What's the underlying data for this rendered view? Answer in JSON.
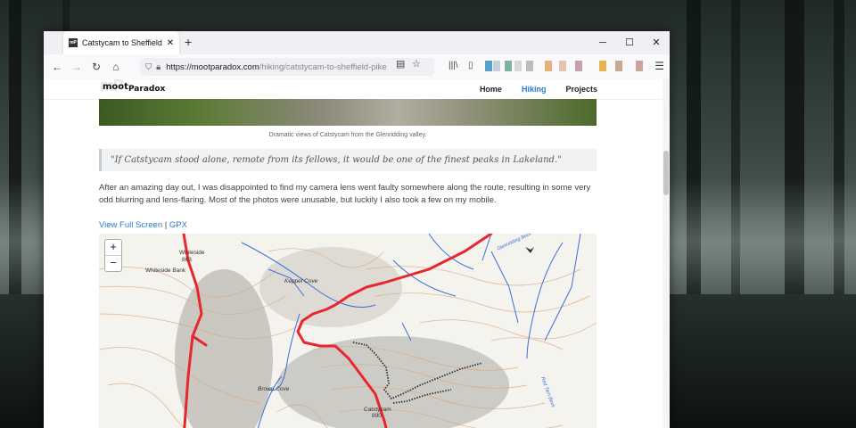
{
  "browser": {
    "tab_title": "Catstycam to Sheffield Pike | m",
    "tab_favicon": "mP",
    "url_host": "https://mootparadox.com",
    "url_path": "/hiking/catstycam-to-sheffield-pike"
  },
  "site": {
    "logo_text": "mootParadox",
    "logo_part1": "moot",
    "logo_part2": "Paradox",
    "nav": [
      "Home",
      "Hiking",
      "Projects"
    ],
    "active_nav": "Hiking"
  },
  "article": {
    "caption": "Dramatic views of Catstycam from the Glenridding valley.",
    "quote": "\"If Catstycam stood alone, remote from its fellows, it would be one of the finest peaks in Lakeland.\"",
    "paragraph": "After an amazing day out, I was disappointed to find my camera lens went faulty somewhere along the route, resulting in some very odd blurring and lens-flaring. Most of the photos were unusable, but luckily I also took a few on my mobile.",
    "link_fullscreen": "View Full Screen",
    "link_separator": "|",
    "link_gpx": "GPX"
  },
  "map": {
    "zoom_in": "+",
    "zoom_out": "−",
    "labels": {
      "whiteside_name": "Whiteside",
      "whiteside_height": "863",
      "whiteside_bank": "Whiteside Bank",
      "keppel_cove": "Keppel Cove",
      "brown_cove": "Brown Cove",
      "catstycam_name": "Catstycam",
      "catstycam_height": "890",
      "red_tarn_beck": "Red Tarn Beck",
      "glenridding_beck": "Glenridding Beck"
    },
    "route_color": "#e8262d",
    "water_color": "#3a6fd8",
    "contour_color": "#d9a77a"
  }
}
